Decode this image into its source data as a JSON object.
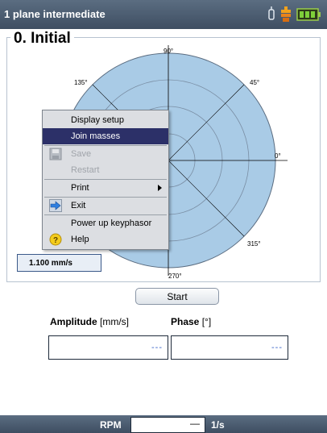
{
  "app": {
    "title": "1 plane intermediate"
  },
  "status_icons": [
    "sensor-icon",
    "keyphasor-icon",
    "battery-icon"
  ],
  "panel": {
    "title": "0. Initial"
  },
  "polar": {
    "angle_labels": {
      "a90": "90°",
      "a45": "45°",
      "a135": "135°",
      "a0": "0°",
      "a315": "315°",
      "a270": "270°"
    },
    "fill_color": "#a9cbe6"
  },
  "amplitude_scale": "1.100 mm/s",
  "context_menu": {
    "items": [
      {
        "label": "Display setup",
        "state": "normal"
      },
      {
        "label": "Join masses",
        "state": "selected"
      },
      {
        "label": "Save",
        "state": "disabled",
        "icon": "save-icon"
      },
      {
        "label": "Restart",
        "state": "disabled"
      },
      {
        "label": "Print",
        "state": "normal",
        "submenu": true
      },
      {
        "label": "Exit",
        "state": "normal",
        "icon": "exit-arrow-icon"
      },
      {
        "label": "Power up keyphasor",
        "state": "normal"
      },
      {
        "label": "Help",
        "state": "normal",
        "icon": "help-icon"
      }
    ]
  },
  "start_button": "Start",
  "results": {
    "amplitude_label": "Amplitude",
    "amplitude_unit": "[mm/s]",
    "phase_label": "Phase",
    "phase_unit": "[°]",
    "amplitude_value": "---",
    "phase_value": "---"
  },
  "rpm": {
    "label": "RPM",
    "value": "—",
    "unit": "1/s"
  }
}
